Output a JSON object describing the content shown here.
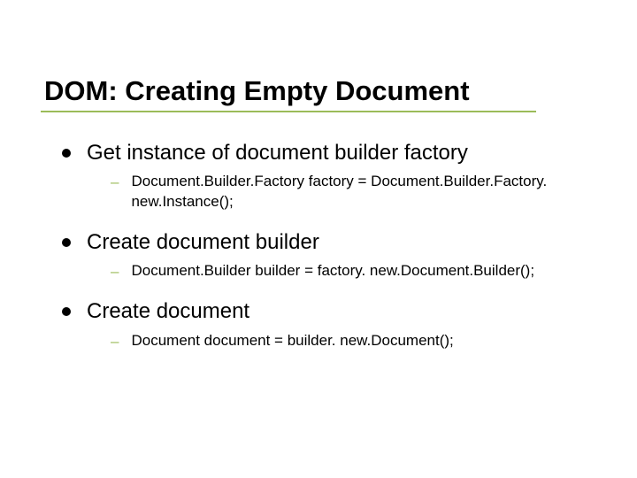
{
  "title": "DOM: Creating Empty Document",
  "items": [
    {
      "label": "Get instance of document builder factory",
      "sub": "Document.Builder.Factory factory = Document.Builder.Factory. new.Instance();"
    },
    {
      "label": "Create document builder",
      "sub": "Document.Builder builder = factory. new.Document.Builder();"
    },
    {
      "label": "Create document",
      "sub": "Document document = builder. new.Document();"
    }
  ]
}
